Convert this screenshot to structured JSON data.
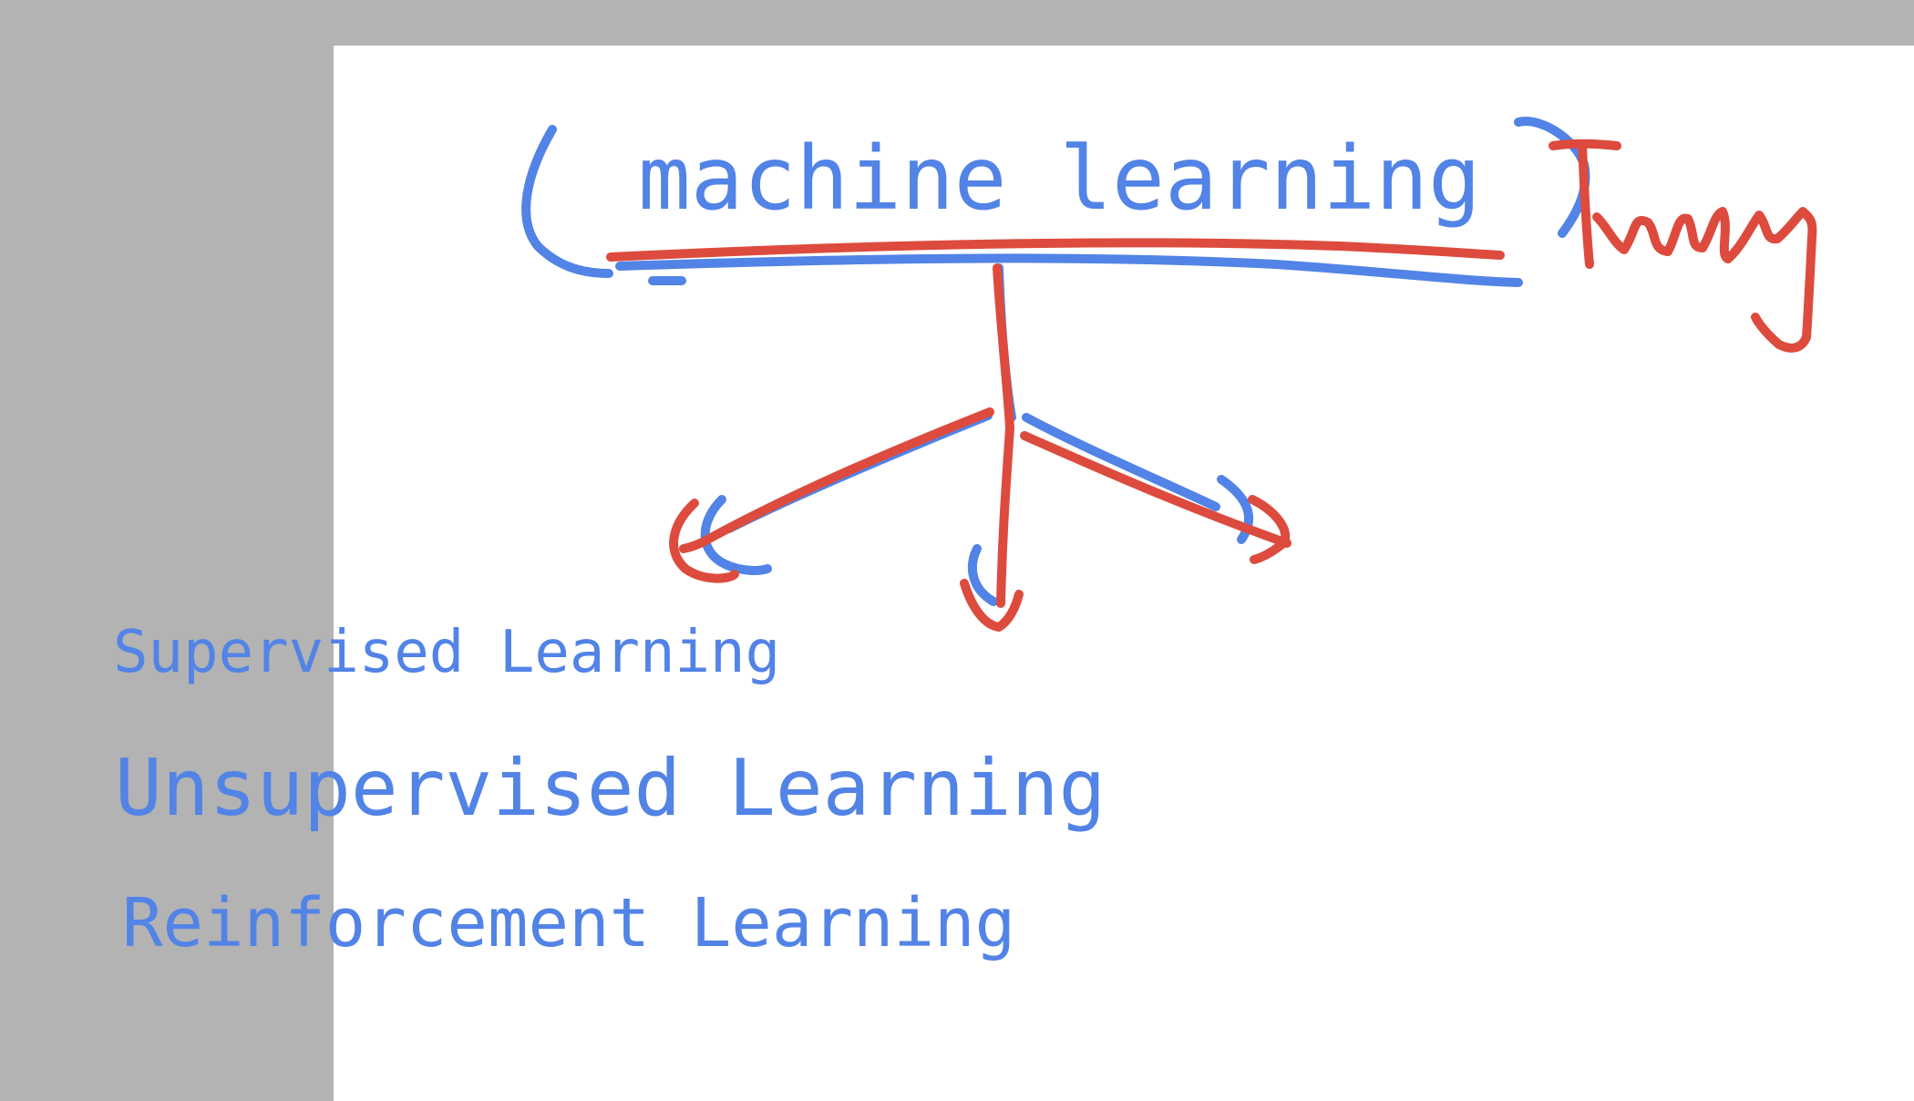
{
  "title": "machine learning",
  "annotation": "Types",
  "branches": [
    "Supervised Learning",
    "Unsupervised Learning",
    "Reinforcement Learning"
  ],
  "colors": {
    "ink_blue": "#5283e6",
    "ink_red": "#dd4b3e",
    "chrome_gray": "#b3b3b3",
    "canvas_white": "#ffffff"
  }
}
